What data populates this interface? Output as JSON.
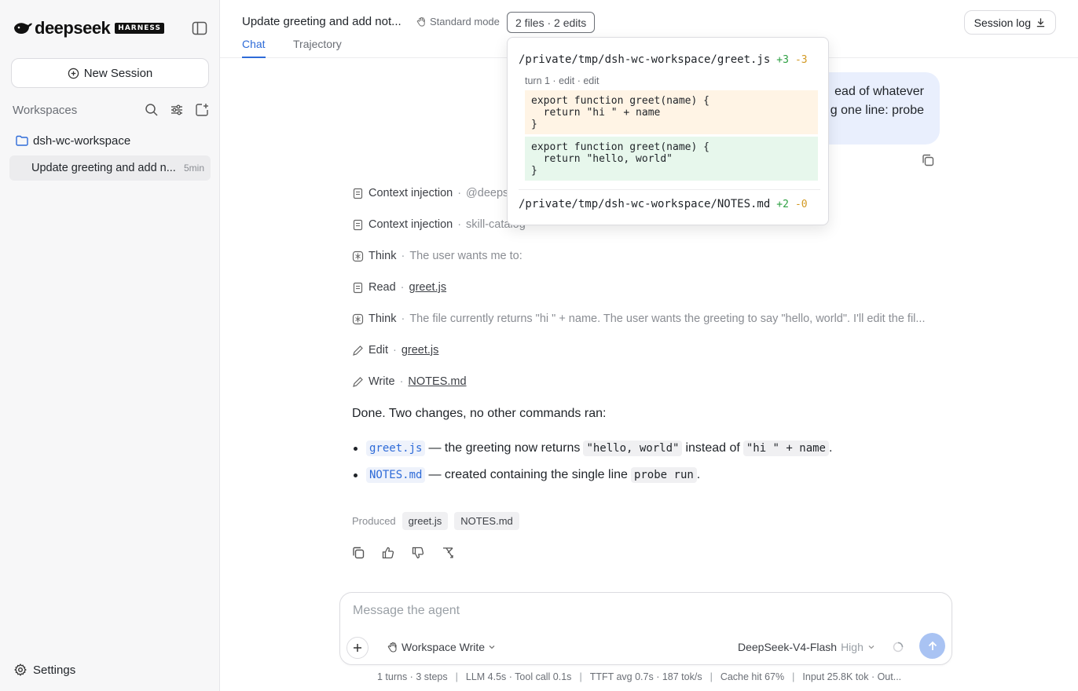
{
  "sidebar": {
    "brand": "deepseek",
    "badge": "HARNESS",
    "new_session": "New Session",
    "workspaces_label": "Workspaces",
    "folder": "dsh-wc-workspace",
    "session": {
      "title": "Update greeting and add n...",
      "age": "5min"
    },
    "settings": "Settings"
  },
  "header": {
    "title": "Update greeting and add not...",
    "mode": "Standard mode",
    "files_chip": "2 files · 2 edits",
    "session_log": "Session log",
    "tabs": [
      {
        "label": "Chat",
        "active": true
      },
      {
        "label": "Trajectory",
        "active": false
      }
    ]
  },
  "user_message": {
    "line1": "ead of whatever",
    "line2": "g one line: probe"
  },
  "steps": [
    {
      "icon": "document-icon",
      "kind": "Context injection",
      "detail": "@deeps"
    },
    {
      "icon": "document-icon",
      "kind": "Context injection",
      "detail": "skill-catalog"
    },
    {
      "icon": "brain-icon",
      "kind": "Think",
      "detail": "The user wants me to:"
    },
    {
      "icon": "document-icon",
      "kind": "Read",
      "link": "greet.js"
    },
    {
      "icon": "brain-icon",
      "kind": "Think",
      "detail": "The file currently returns \"hi \" + name. The user wants the greeting to say \"hello, world\". I'll edit the fil..."
    },
    {
      "icon": "pencil-icon",
      "kind": "Edit",
      "link": "greet.js"
    },
    {
      "icon": "pencil-icon",
      "kind": "Write",
      "link": "NOTES.md"
    }
  ],
  "answer": {
    "intro": "Done. Two changes, no other commands ran:",
    "bullet1": {
      "file": "greet.js",
      "t1": "— the greeting now returns",
      "code1": "\"hello, world\"",
      "t2": "instead of",
      "code2": "\"hi \" + name",
      "end": "."
    },
    "bullet2": {
      "file": "NOTES.md",
      "t1": "— created containing the single line",
      "code1": "probe run",
      "end": "."
    }
  },
  "produced": {
    "label": "Produced",
    "files": [
      "greet.js",
      "NOTES.md"
    ]
  },
  "composer": {
    "placeholder": "Message the agent",
    "workspace": "Workspace Write",
    "model": "DeepSeek-V4-Flash",
    "level": "High"
  },
  "status": {
    "items": [
      "1 turns · 3 steps",
      "LLM 4.5s · Tool call 0.1s",
      "TTFT avg 0.7s · 187 tok/s",
      "Cache hit 67%",
      "Input 25.8K tok · Out..."
    ],
    "sep": "|"
  },
  "popover": {
    "file1": {
      "path": "/private/tmp/dsh-wc-workspace/greet.js",
      "add": "+3",
      "del": "-3"
    },
    "turn": "turn 1 · edit · edit",
    "diff_old": "export function greet(name) {\n  return \"hi \" + name\n}",
    "diff_new": "export function greet(name) {\n  return \"hello, world\"\n}",
    "file2": {
      "path": "/private/tmp/dsh-wc-workspace/NOTES.md",
      "add": "+2",
      "del": "-0"
    }
  },
  "colors": {
    "accent": "#2e6bd8",
    "add": "#2ea043",
    "del": "#d29922",
    "user_bubble": "#e9effd",
    "send": "#a9c3f3"
  }
}
